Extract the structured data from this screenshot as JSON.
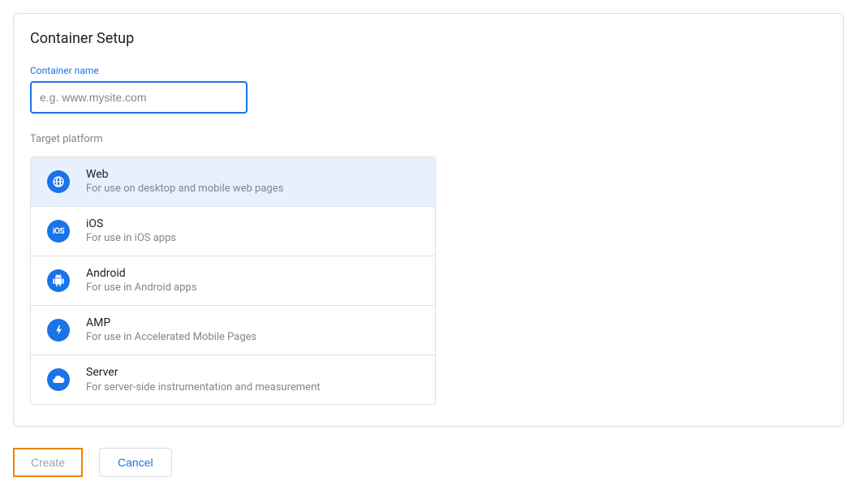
{
  "panel": {
    "title": "Container Setup",
    "containerName": {
      "label": "Container name",
      "placeholder": "e.g. www.mysite.com",
      "value": ""
    },
    "targetPlatform": {
      "label": "Target platform",
      "options": [
        {
          "icon": "globe-icon",
          "title": "Web",
          "desc": "For use on desktop and mobile web pages",
          "selected": true
        },
        {
          "icon": "ios-icon",
          "title": "iOS",
          "desc": "For use in iOS apps",
          "selected": false
        },
        {
          "icon": "android-icon",
          "title": "Android",
          "desc": "For use in Android apps",
          "selected": false
        },
        {
          "icon": "bolt-icon",
          "title": "AMP",
          "desc": "For use in Accelerated Mobile Pages",
          "selected": false
        },
        {
          "icon": "cloud-icon",
          "title": "Server",
          "desc": "For server-side instrumentation and measurement",
          "selected": false
        }
      ]
    }
  },
  "footer": {
    "create": "Create",
    "cancel": "Cancel"
  }
}
